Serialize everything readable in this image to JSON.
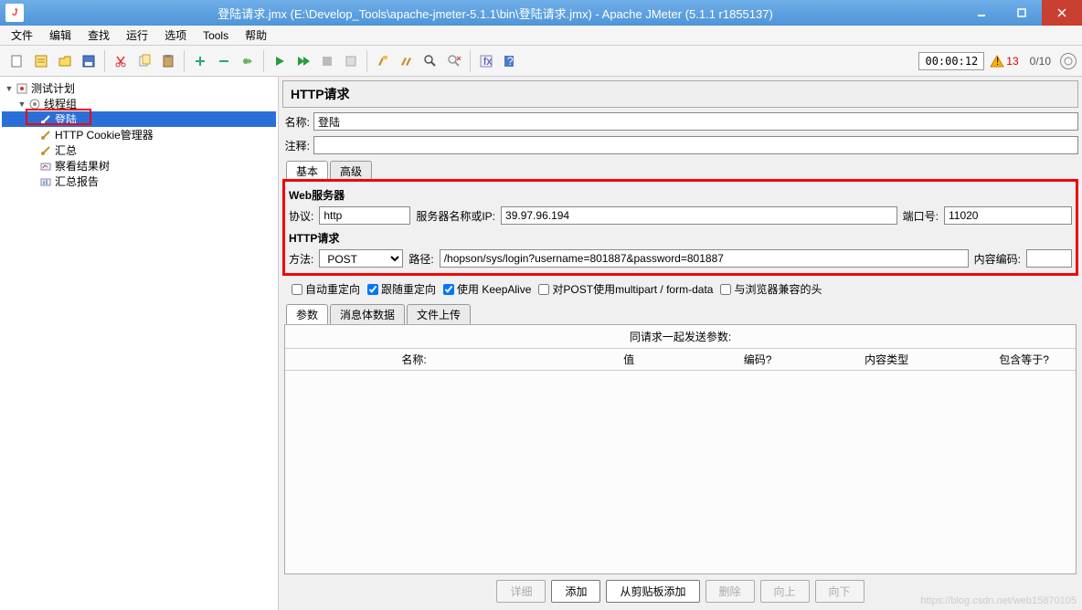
{
  "window": {
    "title": "登陆请求.jmx (E:\\Develop_Tools\\apache-jmeter-5.1.1\\bin\\登陆请求.jmx) - Apache JMeter (5.1.1 r1855137)"
  },
  "menu": {
    "items": [
      "文件",
      "编辑",
      "查找",
      "运行",
      "选项",
      "Tools",
      "帮助"
    ]
  },
  "toolbar": {
    "timer": "00:00:12",
    "warn_count": "13",
    "thread_count": "0/10"
  },
  "tree": {
    "root": "测试计划",
    "group": "线程组",
    "items": [
      "登陆",
      "HTTP Cookie管理器",
      "汇总",
      "察看结果树",
      "汇总报告"
    ]
  },
  "panel": {
    "title": "HTTP请求",
    "name_label": "名称:",
    "name_value": "登陆",
    "comment_label": "注释:",
    "comment_value": "",
    "tab_basic": "基本",
    "tab_adv": "高级"
  },
  "web": {
    "section": "Web服务器",
    "protocol_label": "协议:",
    "protocol": "http",
    "server_label": "服务器名称或IP:",
    "server": "39.97.96.194",
    "port_label": "端口号:",
    "port": "11020"
  },
  "http": {
    "section": "HTTP请求",
    "method_label": "方法:",
    "method": "POST",
    "path_label": "路径:",
    "path": "/hopson/sys/login?username=801887&password=801887",
    "encoding_label": "内容编码:",
    "encoding": ""
  },
  "checks": {
    "c1": "自动重定向",
    "c2": "跟随重定向",
    "c3": "使用 KeepAlive",
    "c4": "对POST使用multipart / form-data",
    "c5": "与浏览器兼容的头"
  },
  "param_tabs": [
    "参数",
    "消息体数据",
    "文件上传"
  ],
  "table": {
    "caption": "同请求一起发送参数:",
    "headers": [
      "名称:",
      "值",
      "编码?",
      "内容类型",
      "包含等于?"
    ]
  },
  "buttons": {
    "detail": "详细",
    "add": "添加",
    "clipboard": "从剪贴板添加",
    "delete": "删除",
    "up": "向上",
    "down": "向下"
  },
  "watermark": "https://blog.csdn.net/web15870105"
}
